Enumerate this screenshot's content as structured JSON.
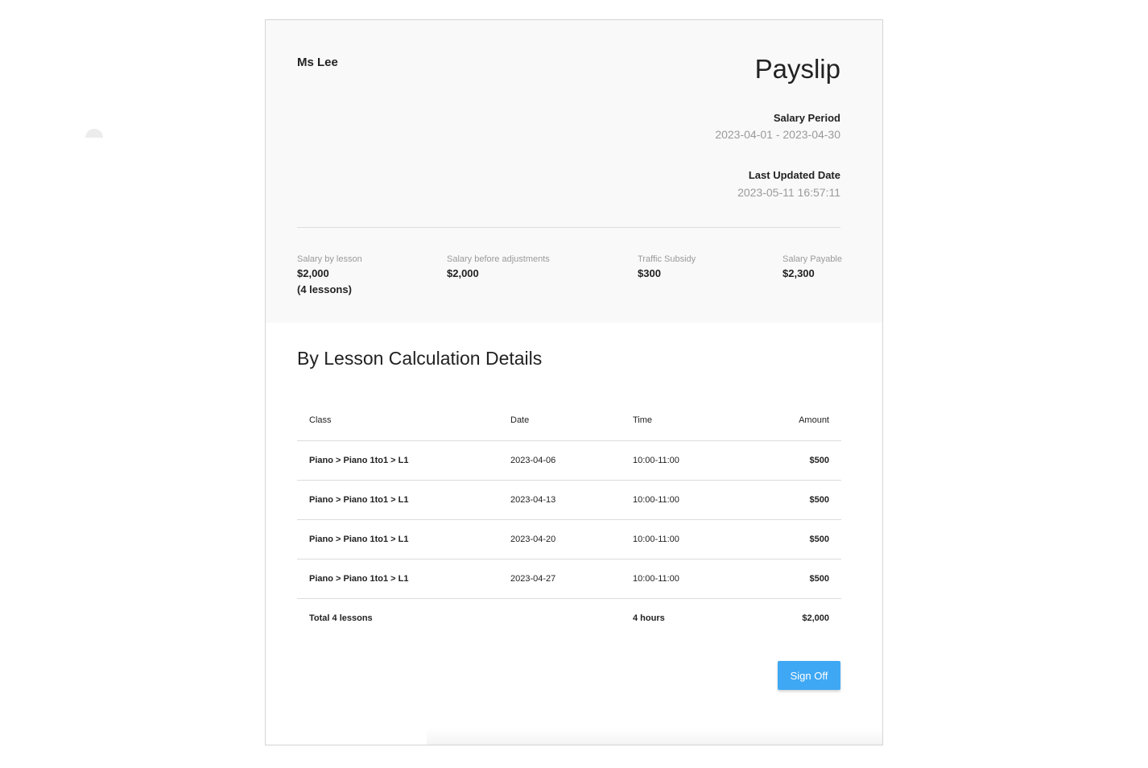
{
  "teacher": "Ms Lee",
  "title": "Payslip",
  "salary_period": {
    "label": "Salary Period",
    "value": "2023-04-01 - 2023-04-30"
  },
  "last_updated": {
    "label": "Last Updated Date",
    "value": "2023-05-11 16:57:11"
  },
  "summary": {
    "by_lesson": {
      "label": "Salary by lesson",
      "value": "$2,000",
      "sub": "(4 lessons)"
    },
    "before_adjustments": {
      "label": "Salary before adjustments",
      "value": "$2,000"
    },
    "traffic_subsidy": {
      "label": "Traffic Subsidy",
      "value": "$300"
    },
    "payable": {
      "label": "Salary Payable",
      "value": "$2,300"
    }
  },
  "details": {
    "title": "By Lesson Calculation Details",
    "headers": {
      "class": "Class",
      "date": "Date",
      "time": "Time",
      "amount": "Amount"
    },
    "rows": [
      {
        "class": "Piano > Piano 1to1 > L1",
        "date": "2023-04-06",
        "time": "10:00-11:00",
        "amount": "$500"
      },
      {
        "class": "Piano > Piano 1to1 > L1",
        "date": "2023-04-13",
        "time": "10:00-11:00",
        "amount": "$500"
      },
      {
        "class": "Piano > Piano 1to1 > L1",
        "date": "2023-04-20",
        "time": "10:00-11:00",
        "amount": "$500"
      },
      {
        "class": "Piano > Piano 1to1 > L1",
        "date": "2023-04-27",
        "time": "10:00-11:00",
        "amount": "$500"
      }
    ],
    "total": {
      "label": "Total 4 lessons",
      "time": "4 hours",
      "amount": "$2,000"
    }
  },
  "actions": {
    "sign_off": "Sign Off"
  },
  "colors": {
    "accent": "#3fa8f4",
    "summary_bg": "#f9f9f9",
    "muted_text": "#9a9a9a"
  }
}
